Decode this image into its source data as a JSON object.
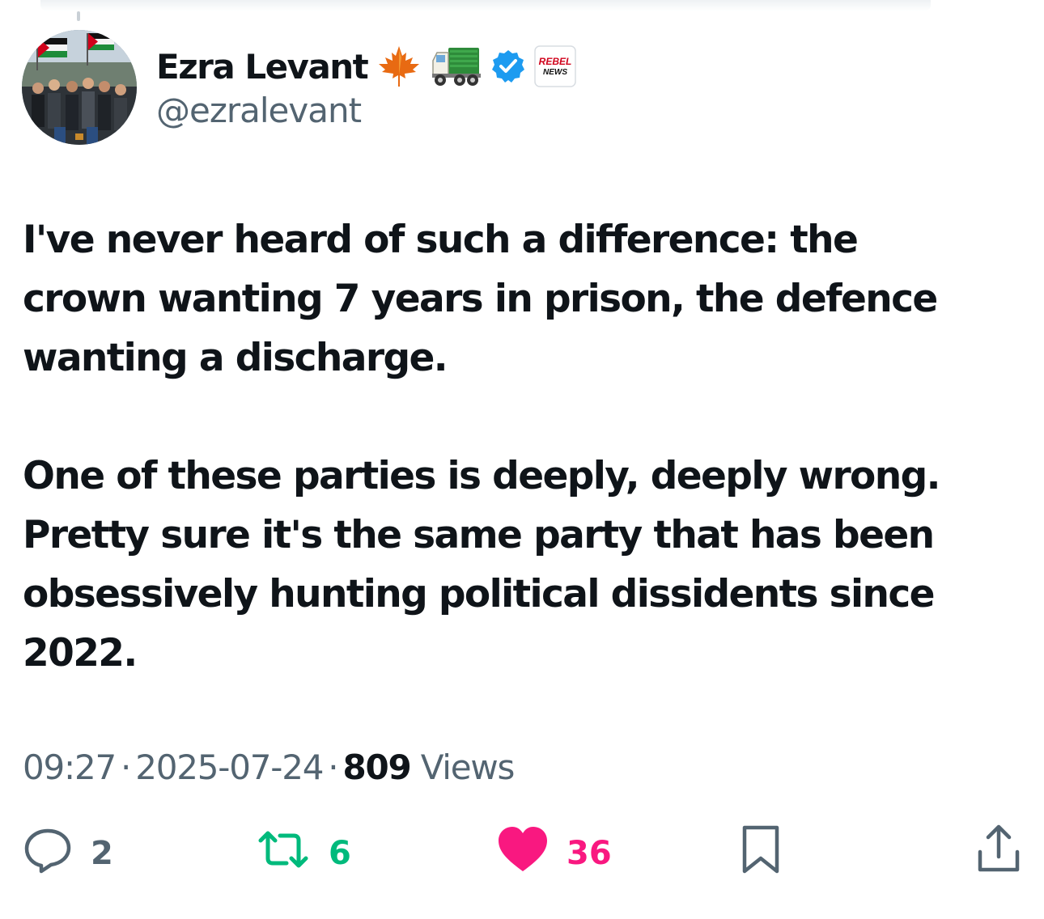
{
  "author": {
    "display_name": "Ezra Levant",
    "handle": "@ezralevant",
    "name_emojis": [
      "maple-leaf-icon",
      "truck-icon"
    ],
    "verified": true,
    "affiliate_badge": {
      "name": "rebel-news-badge",
      "line1": "REBEL",
      "line2": "NEWS"
    }
  },
  "tweet": {
    "paragraphs": [
      [
        "I've never heard of such a difference: the",
        "crown wanting 7 years in prison, the defence",
        "wanting a discharge."
      ],
      [
        "One of these parties is deeply, deeply wrong.",
        "Pretty sure it's the same party that has been",
        "obsessively hunting political dissidents since",
        "2022."
      ]
    ]
  },
  "meta": {
    "time": "09:27",
    "separator": "·",
    "date": "2025-07-24",
    "views_count": "809",
    "views_label": "Views"
  },
  "actions": {
    "replies": "2",
    "retweets": "6",
    "likes": "36"
  },
  "colors": {
    "text_primary": "#0f1419",
    "text_secondary": "#536471",
    "verified_blue": "#1d9bf0",
    "retweet_green": "#00ba7c",
    "like_pink": "#f91880",
    "rebel_red": "#d0021b"
  }
}
